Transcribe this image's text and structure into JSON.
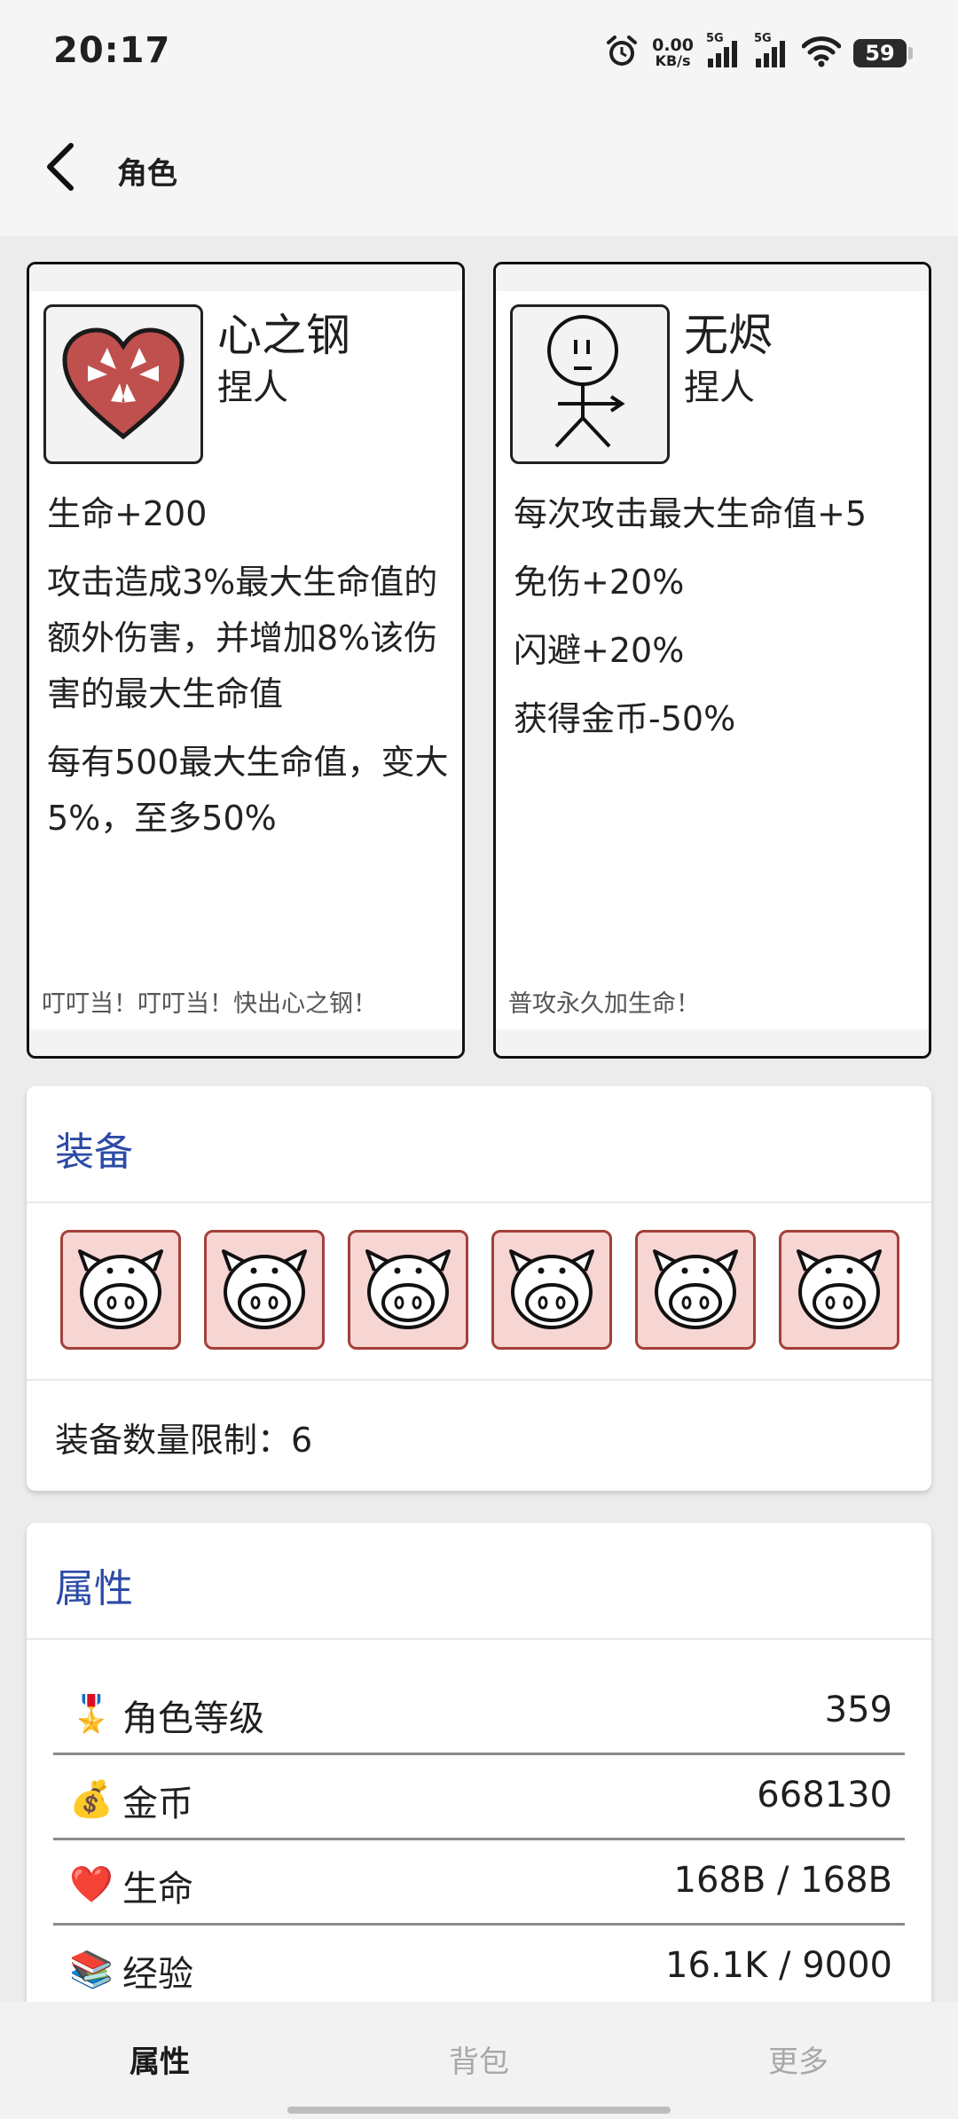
{
  "status_bar": {
    "time": "20:17",
    "net_speed_value": "0.00",
    "net_speed_unit": "KB/s",
    "signal1_label": "5G",
    "signal2_label": "5G",
    "battery": "59"
  },
  "app_bar": {
    "title": "角色"
  },
  "characters": [
    {
      "name": "心之钢",
      "subtitle": "捏人",
      "portrait_icon": "heart-icon",
      "effects": [
        "生命+200",
        "攻击造成3%最大生命值的额外伤害，并增加8%该伤害的最大生命值",
        "每有500最大生命值，变大5%，至多50%"
      ],
      "quote": "叮叮当！叮叮当！快出心之钢！"
    },
    {
      "name": "无烬",
      "subtitle": "捏人",
      "portrait_icon": "stick-figure-icon",
      "effects": [
        "每次攻击最大生命值+5",
        "免伤+20%",
        "闪避+20%",
        "获得金币-50%"
      ],
      "quote": "普攻永久加生命！"
    }
  ],
  "equipment": {
    "title": "装备",
    "slot_icon": "pig-face-icon",
    "slot_count": 6,
    "limit_text": "装备数量限制：6"
  },
  "attributes": {
    "title": "属性",
    "rows": [
      {
        "icon": "medal-icon",
        "glyph": "🎖️",
        "label": "角色等级",
        "value": "359"
      },
      {
        "icon": "money-bag-icon",
        "glyph": "💰",
        "label": "金币",
        "value": "668130"
      },
      {
        "icon": "heart-icon",
        "glyph": "❤️",
        "label": "生命",
        "value": "168B / 168B"
      },
      {
        "icon": "books-icon",
        "glyph": "📚",
        "label": "经验",
        "value": "16.1K / 9000"
      }
    ]
  },
  "bottom_nav": {
    "items": [
      {
        "label": "属性",
        "active": true
      },
      {
        "label": "背包",
        "active": false
      },
      {
        "label": "更多",
        "active": false
      }
    ]
  },
  "colors": {
    "accent_title": "#2b4aa6",
    "slot_bg": "#f7d5d3",
    "slot_border": "#a3403a",
    "heart_red": "#c0504d"
  }
}
